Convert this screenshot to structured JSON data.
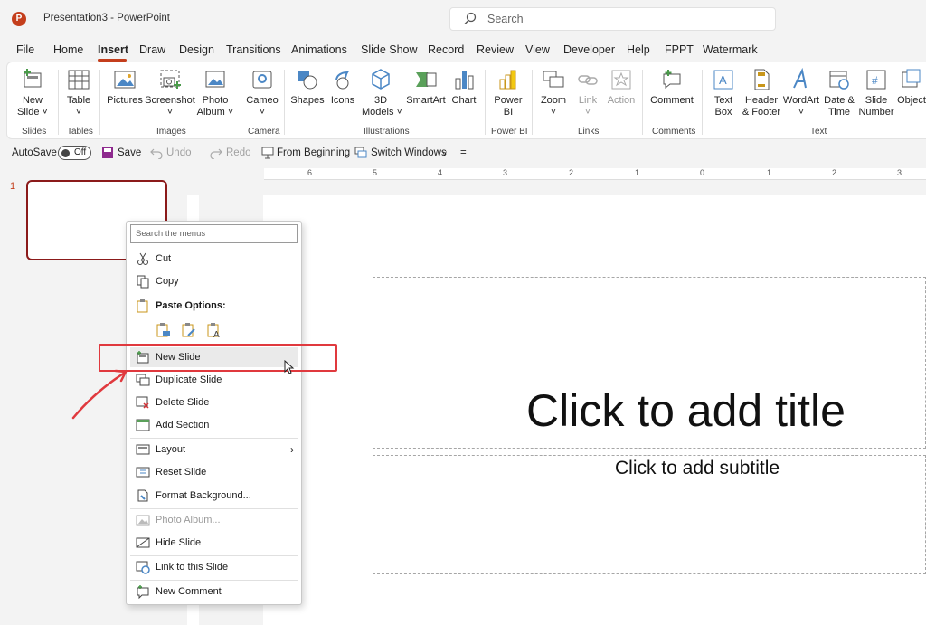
{
  "titlebar": {
    "app_title": "Presentation3  -  PowerPoint",
    "logo_letter": "P",
    "search_placeholder": "Search"
  },
  "menubar": {
    "tabs": [
      "File",
      "Home",
      "Insert",
      "Draw",
      "Design",
      "Transitions",
      "Animations",
      "Slide Show",
      "Record",
      "Review",
      "View",
      "Developer",
      "Help",
      "FPPT",
      "Watermark"
    ],
    "active": "Insert"
  },
  "ribbon": {
    "buttons": [
      {
        "label": "New\nSlide ˅",
        "icon": "new-slide-icon"
      },
      {
        "label": "Table\n˅",
        "icon": "table-icon"
      },
      {
        "label": "Pictures\n ",
        "icon": "pictures-icon"
      },
      {
        "label": "Screenshot\n˅",
        "icon": "screenshot-icon"
      },
      {
        "label": "Photo\nAlbum ˅",
        "icon": "photo-album-icon"
      },
      {
        "label": "Cameo\n˅",
        "icon": "cameo-icon"
      },
      {
        "label": "Shapes\n ",
        "icon": "shapes-icon"
      },
      {
        "label": "Icons\n ",
        "icon": "icons-icon"
      },
      {
        "label": "3D\nModels ˅",
        "icon": "3d-models-icon"
      },
      {
        "label": "SmartArt\n ",
        "icon": "smartart-icon"
      },
      {
        "label": "Chart\n ",
        "icon": "chart-icon"
      },
      {
        "label": "Power\nBI",
        "icon": "power-bi-icon"
      },
      {
        "label": "Zoom\n˅",
        "icon": "zoom-icon"
      },
      {
        "label": "Link\n˅",
        "icon": "link-icon"
      },
      {
        "label": "Action\n ",
        "icon": "action-icon"
      },
      {
        "label": "Comment\n ",
        "icon": "comment-icon"
      },
      {
        "label": "Text\nBox",
        "icon": "text-box-icon"
      },
      {
        "label": "Header\n& Footer",
        "icon": "header-footer-icon"
      },
      {
        "label": "WordArt\n˅",
        "icon": "wordart-icon"
      },
      {
        "label": "Date &\nTime",
        "icon": "date-time-icon"
      },
      {
        "label": "Slide\nNumber",
        "icon": "slide-number-icon"
      },
      {
        "label": "Object\n ",
        "icon": "object-icon"
      }
    ],
    "groups": [
      "Slides",
      "Tables",
      "Images",
      "Camera",
      "Illustrations",
      "Power BI",
      "Links",
      "Comments",
      "Text"
    ]
  },
  "qat": {
    "autosave": "AutoSave",
    "toggle": "Off",
    "save": "Save",
    "undo": "Undo",
    "redo": "Redo",
    "from_beginning": "From Beginning",
    "switch_windows": "Switch Windows",
    "more": "="
  },
  "ruler": {
    "ticks": [
      "6",
      "5",
      "4",
      "3",
      "2",
      "1",
      "0",
      "1",
      "2",
      "3"
    ]
  },
  "thumbnails": {
    "number": "1"
  },
  "slide": {
    "title": "Click to add title",
    "subtitle": "Click to add subtitle"
  },
  "context_menu": {
    "search_placeholder": "Search the menus",
    "items": [
      {
        "label": "Cut",
        "icon": "scissors-icon"
      },
      {
        "label": "Copy",
        "icon": "copy-icon"
      },
      {
        "label": "Paste Options:",
        "icon": "paste-icon"
      },
      {
        "label": "New Slide",
        "icon": "new-slide-icon"
      },
      {
        "label": "Duplicate Slide",
        "icon": "duplicate-slide-icon"
      },
      {
        "label": "Delete Slide",
        "icon": "delete-slide-icon"
      },
      {
        "label": "Add Section",
        "icon": "add-section-icon"
      },
      {
        "label": "Layout",
        "icon": "layout-icon"
      },
      {
        "label": "Reset Slide",
        "icon": "reset-slide-icon"
      },
      {
        "label": "Format Background...",
        "icon": "format-background-icon"
      },
      {
        "label": "Photo Album...",
        "icon": "photo-album-icon"
      },
      {
        "label": "Hide Slide",
        "icon": "hide-slide-icon"
      },
      {
        "label": "Link to this Slide",
        "icon": "link-slide-icon"
      },
      {
        "label": "New Comment",
        "icon": "new-comment-icon"
      }
    ]
  },
  "colors": {
    "accent": "#c43e1c",
    "highlight": "#e0393e",
    "thumb_border": "#8b1a1a"
  }
}
